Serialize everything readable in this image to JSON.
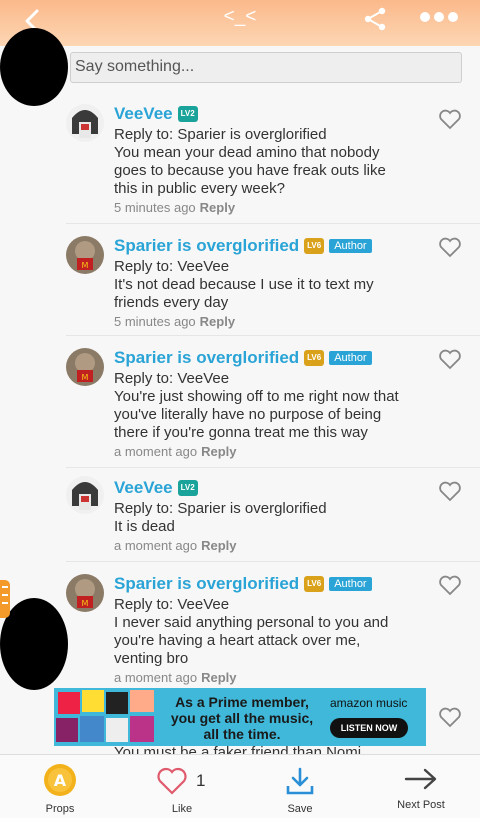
{
  "header": {
    "title": "<_<"
  },
  "reply_box": {
    "placeholder": "Say something..."
  },
  "comments": [
    {
      "username": "VeeVee",
      "level": "LV2",
      "author": false,
      "text": [
        "Reply to: Sparier is overglorified",
        "You mean your dead amino that nobody",
        "goes to because you have freak outs like",
        "this in public every week?"
      ],
      "time": "5 minutes ago",
      "reply": "Reply"
    },
    {
      "username": "Sparier is overglorified",
      "level": "LV6",
      "author": true,
      "author_label": "Author",
      "text": [
        "Reply to: VeeVee",
        "It's not dead because I use it to text my",
        "friends every day"
      ],
      "time": "5 minutes ago",
      "reply": "Reply"
    },
    {
      "username": "Sparier is overglorified",
      "level": "LV6",
      "author": true,
      "author_label": "Author",
      "text": [
        "Reply to: VeeVee",
        "You're just showing off to me right now that",
        "you've literally have no purpose of being",
        "there if you're gonna treat me this way"
      ],
      "time": "a moment ago",
      "reply": "Reply"
    },
    {
      "username": "VeeVee",
      "level": "LV2",
      "author": false,
      "text": [
        "Reply to: Sparier is overglorified",
        "It is dead"
      ],
      "time": "a moment ago",
      "reply": "Reply"
    },
    {
      "username": "Sparier is overglorified",
      "level": "LV6",
      "author": true,
      "author_label": "Author",
      "text": [
        "Reply to: VeeVee",
        "I never said anything personal to you and",
        "you're having a heart attack over me,",
        "venting bro"
      ],
      "time": "a moment ago",
      "reply": "Reply"
    }
  ],
  "ad": {
    "line1": "As a Prime member,",
    "line2": "you get all the music,",
    "line3": "all the time.",
    "brand": "amazon music",
    "button": "LISTEN NOW"
  },
  "peek_text": "You must be a faker friend than Nomi",
  "bottom_bar": {
    "props_label": "Props",
    "like_label": "Like",
    "like_count": "1",
    "save_label": "Save",
    "next_label": "Next Post"
  },
  "colors": {
    "header_top": "#fbb98a",
    "username": "#2aa4d6",
    "author_badge": "#2aa4d6",
    "lv2": "#1aa39a",
    "lv6": "#d9a21a",
    "props": "#f3b21c",
    "heart": "#e05a6d",
    "save": "#2a8fd6"
  }
}
